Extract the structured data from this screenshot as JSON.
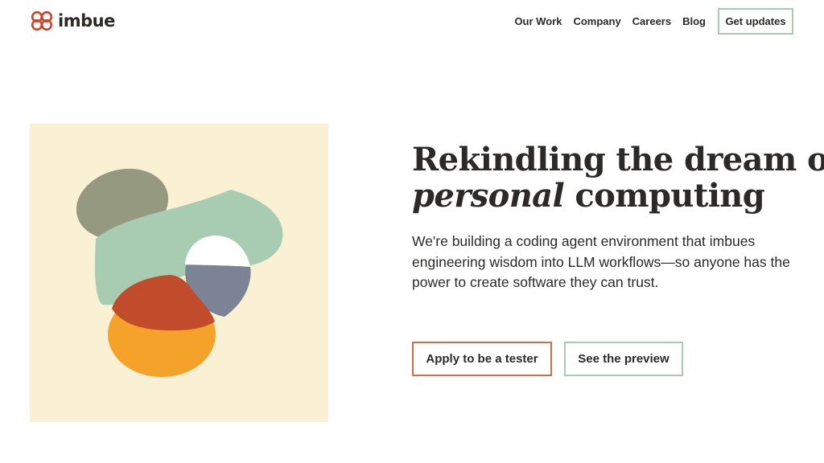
{
  "brand": {
    "name": "imbue",
    "logo_icon": "imbue-logo-icon",
    "accent_color": "#c9462a"
  },
  "nav": {
    "links": [
      "Our Work",
      "Company",
      "Careers",
      "Blog"
    ],
    "cta_label": "Get updates"
  },
  "hero": {
    "title_line1": "Rekindling the dream of",
    "title_italic": "personal",
    "title_rest": " computing",
    "description": "We're building a coding agent environment that imbues engineering wisdom into LLM workflows—so anyone has the power to create software they can trust.",
    "primary_button": "Apply to be a tester",
    "secondary_button": "See the preview"
  },
  "colors": {
    "art_background": "#faf1d5",
    "blob_olive": "#94997f",
    "blob_green": "#a7ccb1",
    "blob_red": "#c04c2c",
    "blob_orange": "#f4a22a",
    "blob_slate": "#7b8395",
    "primary_button_border": "#d86a46",
    "secondary_button_border": "#a8cbb2"
  }
}
